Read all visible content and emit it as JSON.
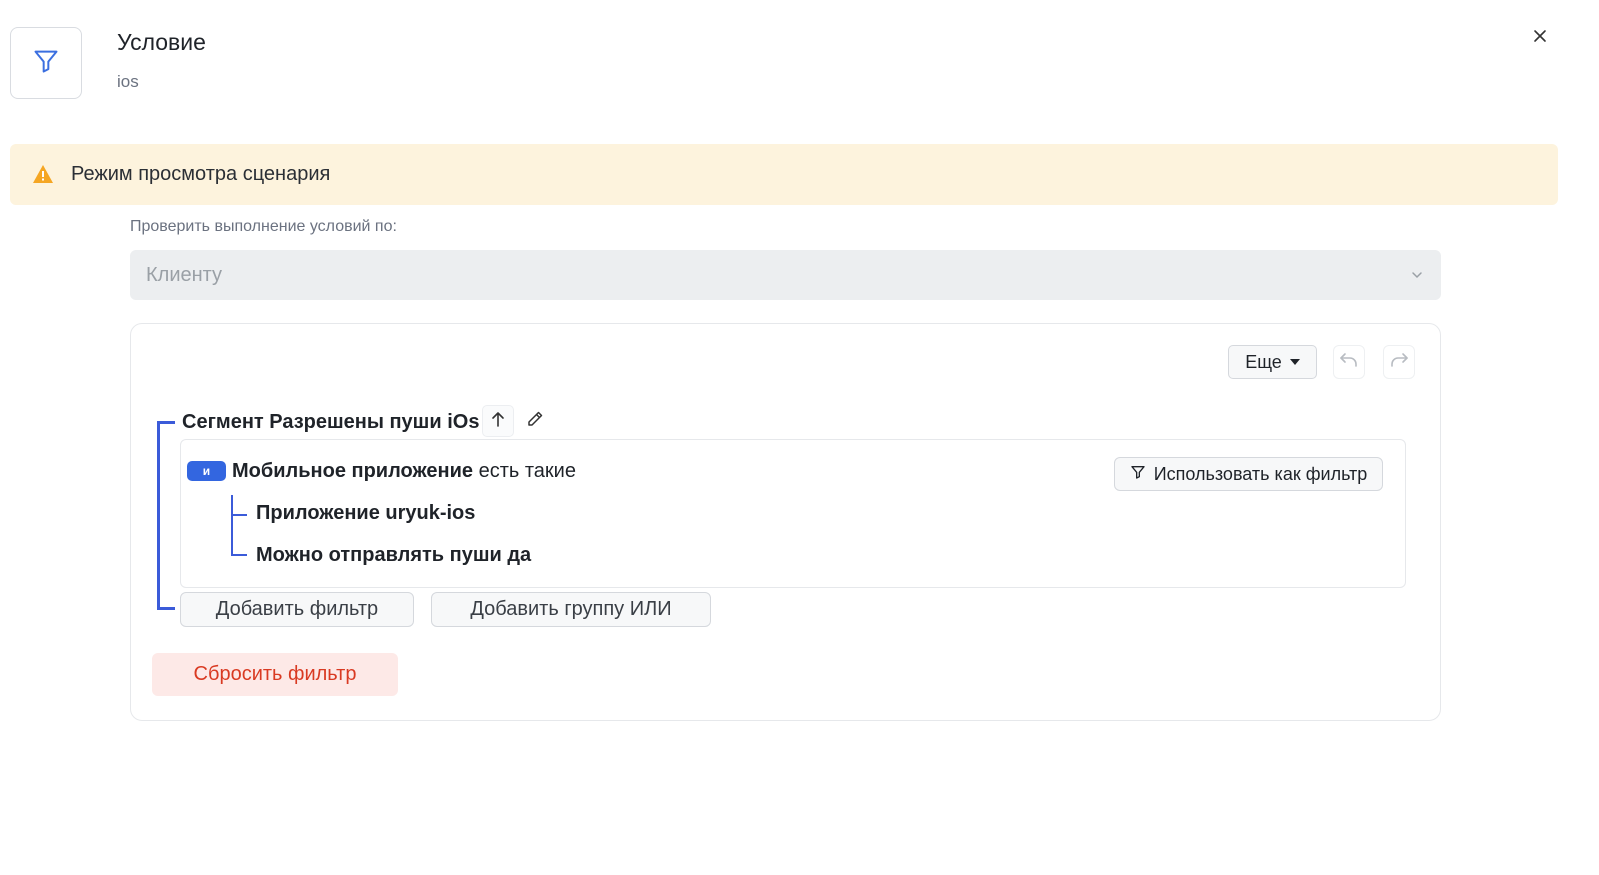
{
  "header": {
    "title": "Условие",
    "subtitle": "ios",
    "icon": "filter-icon",
    "close_icon": "close-icon"
  },
  "banner": {
    "icon": "warning-icon",
    "text": "Режим просмотра сценария",
    "background": "#fdf3dd",
    "icon_color": "#f5a623"
  },
  "check_by": {
    "label": "Проверить выполнение условий по:",
    "value": "Клиенту"
  },
  "toolbar": {
    "more_label": "Еще",
    "undo_icon": "undo-icon",
    "redo_icon": "redo-icon"
  },
  "segment": {
    "title": "Сегмент Разрешены пуши iOs",
    "move_up_icon": "arrow-up-icon",
    "edit_icon": "pencil-icon",
    "operator_badge": "и",
    "condition_bold": "Мобильное приложение",
    "condition_rest": " есть такие",
    "use_as_filter_label": "Использовать как фильтр",
    "sub_conditions": [
      "Приложение uryuk-ios",
      "Можно отправлять пуши да"
    ]
  },
  "actions": {
    "add_filter": "Добавить фильтр",
    "add_or_group": "Добавить группу ИЛИ",
    "reset_filter": "Сбросить фильтр"
  },
  "colors": {
    "accent": "#3b5bd9",
    "badge": "#3366e0",
    "danger": "#d93a22"
  }
}
